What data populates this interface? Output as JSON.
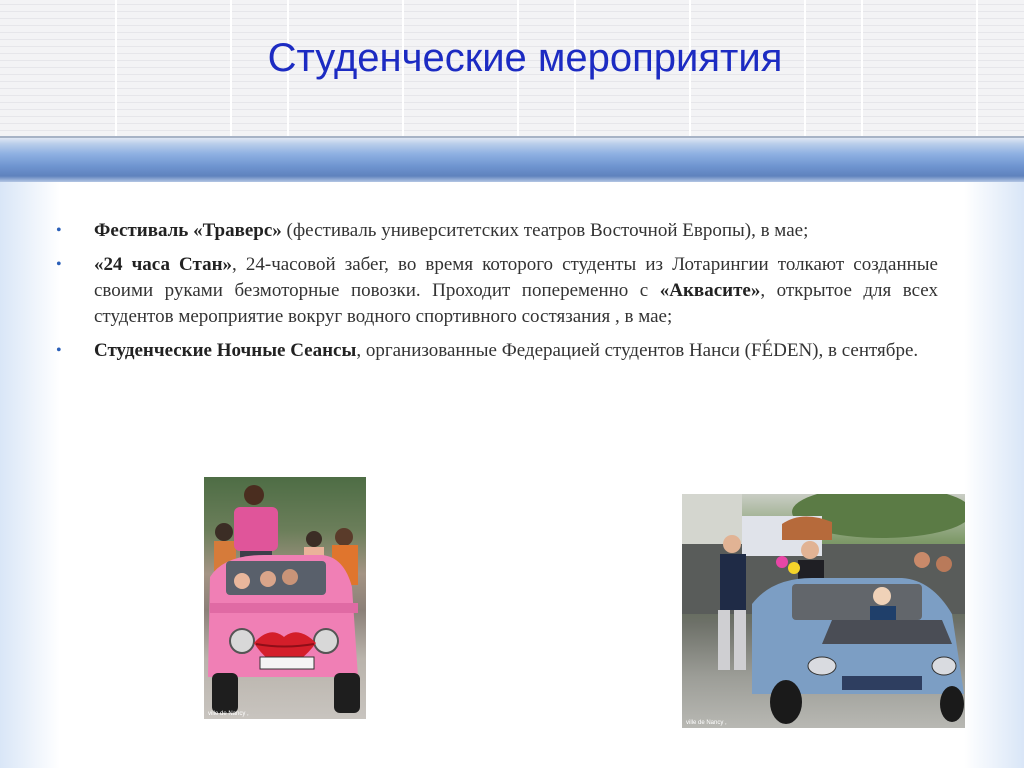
{
  "slide": {
    "title": "Студенческие мероприятия"
  },
  "bullets": [
    {
      "bold": "Фестиваль «Траверс»",
      "text1": " (фестиваль университетских театров Восточной Европы), в мае;",
      "bold2": "",
      "text2": ""
    },
    {
      "bold": "«24 часа Стан»",
      "text1": ", 24-часовой забег, во время которого студенты из Лотарингии толкают созданные своими руками безмоторные повозки. Проходит попеременно с ",
      "bold2": "«Аквасите»",
      "text2": ", открытое для всех студентов мероприятие вокруг водного спортивного состязания , в мае;"
    },
    {
      "bold": "Студенческие Ночные Сеансы",
      "text1": ", организованные Федерацией студентов Нанси (FÉDEN), в сентябре.",
      "bold2": "",
      "text2": ""
    }
  ],
  "photos": {
    "left_credit": "ville de Nancy ,",
    "right_credit": "ville de Nancy ,"
  },
  "icons": {
    "bullet": "•"
  },
  "colors": {
    "title": "#1c2bc2",
    "bullet": "#2a5fb8",
    "body_text": "#333333"
  }
}
